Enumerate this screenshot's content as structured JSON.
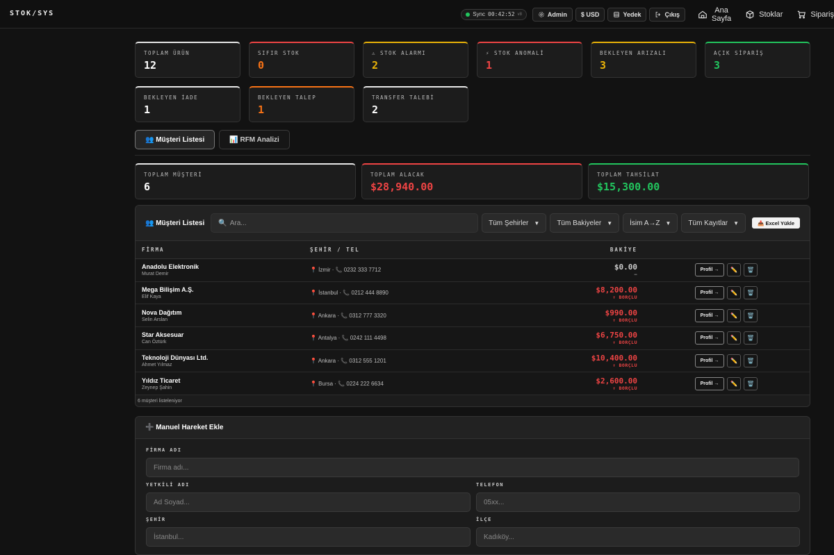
{
  "app": {
    "logo": "STOK/SYS"
  },
  "topbar": {
    "sync_label": "Sync",
    "sync_time": "00:42:52",
    "sync_version": "v8",
    "admin": "Admin",
    "currency": "$ USD",
    "backup": "Yedek",
    "logout": "Çıkış",
    "nav": [
      {
        "label_line1": "Ana",
        "label_line2": "Sayfa",
        "icon": "home-icon"
      },
      {
        "label": "Stoklar",
        "icon": "box-icon"
      },
      {
        "label": "Sipariş",
        "icon": "cart-icon"
      }
    ]
  },
  "colors": {
    "accent_white": "#e8e8e8",
    "accent_red": "#ef4444",
    "accent_orange": "#f97316",
    "accent_yellow": "#eab308",
    "accent_green": "#22c55e"
  },
  "stat_cards": [
    {
      "label": "TOPLAM ÜRÜN",
      "value": "12",
      "color": "#ffffff",
      "border": "#e8e8e8"
    },
    {
      "label": "SIFIR STOK",
      "value": "0",
      "color": "#f97316",
      "border": "#ef4444"
    },
    {
      "label": "⚠ STOK ALARMI",
      "value": "2",
      "color": "#eab308",
      "border": "#eab308"
    },
    {
      "label": "⚡ STOK ANOMALİ",
      "value": "1",
      "color": "#ef4444",
      "border": "#ef4444"
    },
    {
      "label": "BEKLEYEN ARIZALI",
      "value": "3",
      "color": "#eab308",
      "border": "#eab308"
    },
    {
      "label": "AÇIK SİPARİŞ",
      "value": "3",
      "color": "#22c55e",
      "border": "#22c55e"
    },
    {
      "label": "BEKLEYEN İADE",
      "value": "1",
      "color": "#ffffff",
      "border": "#e8e8e8"
    },
    {
      "label": "BEKLEYEN TALEP",
      "value": "1",
      "color": "#f97316",
      "border": "#f97316"
    },
    {
      "label": "TRANSFER TALEBİ",
      "value": "2",
      "color": "#ffffff",
      "border": "#e8e8e8"
    }
  ],
  "tabs": [
    {
      "label": "👥 Müşteri Listesi",
      "active": true
    },
    {
      "label": "📊 RFM Analizi",
      "active": false
    }
  ],
  "summary": [
    {
      "label": "TOPLAM MÜŞTERİ",
      "value": "6",
      "color": "#ffffff",
      "border": "#e8e8e8"
    },
    {
      "label": "TOPLAM ALACAK",
      "value": "$28,940.00",
      "color": "#ef4444",
      "border": "#ef4444"
    },
    {
      "label": "TOPLAM TAHSİLAT",
      "value": "$15,300.00",
      "color": "#22c55e",
      "border": "#22c55e"
    }
  ],
  "list": {
    "title": "👥 Müşteri Listesi",
    "search_placeholder": "Ara...",
    "filters": [
      "Tüm Şehirler",
      "Tüm Bakiyeler",
      "İsim A→Z",
      "Tüm Kayıtlar"
    ],
    "excel_label": "📥 Excel Yükle",
    "columns": [
      "FİRMA",
      "ŞEHİR / TEL",
      "BAKİYE"
    ],
    "profile_label": "Profil →",
    "rows": [
      {
        "firm": "Anadolu Elektronik",
        "contact": "Murat Demir",
        "city": "📍 İzmir · 📞 0232 333 7712",
        "balance": "$0.00",
        "status": "—",
        "zero": true
      },
      {
        "firm": "Mega Bilişim A.Ş.",
        "contact": "Elif Kaya",
        "city": "📍 İstanbul · 📞 0212 444 8890",
        "balance": "$8,200.00",
        "status": "↑ BORÇLU",
        "zero": false
      },
      {
        "firm": "Nova Dağıtım",
        "contact": "Selin Arslan",
        "city": "📍 Ankara · 📞 0312 777 3320",
        "balance": "$990.00",
        "status": "↑ BORÇLU",
        "zero": false
      },
      {
        "firm": "Star Aksesuar",
        "contact": "Can Öztürk",
        "city": "📍 Antalya · 📞 0242 111 4498",
        "balance": "$6,750.00",
        "status": "↑ BORÇLU",
        "zero": false
      },
      {
        "firm": "Teknoloji Dünyası Ltd.",
        "contact": "Ahmet Yılmaz",
        "city": "📍 Ankara · 📞 0312 555 1201",
        "balance": "$10,400.00",
        "status": "↑ BORÇLU",
        "zero": false
      },
      {
        "firm": "Yıldız Ticaret",
        "contact": "Zeynep Şahin",
        "city": "📍 Bursa · 📞 0224 222 6634",
        "balance": "$2,600.00",
        "status": "↑ BORÇLU",
        "zero": false
      }
    ],
    "footer": "6 müşteri listeleniyor"
  },
  "form": {
    "title": "➕ Manuel Hareket Ekle",
    "firm_label": "FİRMA ADI",
    "firm_placeholder": "Firma adı...",
    "contact_label": "YETKİLİ ADI",
    "contact_placeholder": "Ad Soyad...",
    "phone_label": "TELEFON",
    "phone_placeholder": "05xx...",
    "city_label": "ŞEHİR",
    "city_placeholder": "İstanbul...",
    "district_label": "İLÇE",
    "district_placeholder": "Kadıköy..."
  }
}
